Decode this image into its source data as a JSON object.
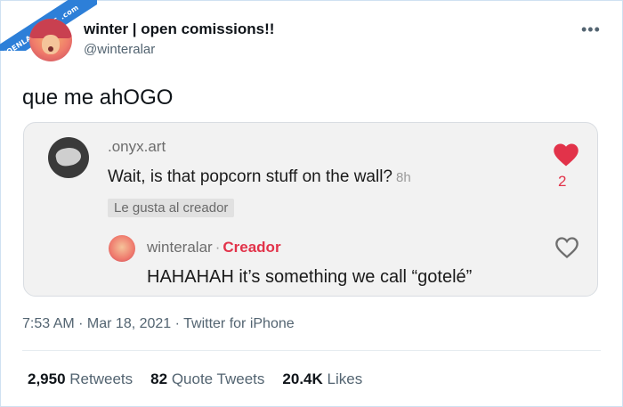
{
  "watermark": "VISTOENLASREDES .com",
  "author": {
    "name": "winter | open comissions!!",
    "handle": "@winteralar"
  },
  "tweet_text": "que me ahOGO",
  "card": {
    "commenter": ".onyx.art",
    "comment": "Wait, is that popcorn stuff on the wall?",
    "comment_time": "8h",
    "liked_badge": "Le gusta al creador",
    "like_count": "2",
    "reply_user": "winteralar",
    "reply_sep": "·",
    "reply_role": "Creador",
    "reply_text": "HAHAHAH it’s something we call “gotelé”"
  },
  "meta": "7:53 AM · Mar 18, 2021 · Twitter for iPhone",
  "stats": {
    "retweets_count": "2,950",
    "retweets_label": "Retweets",
    "quotes_count": "82",
    "quotes_label": "Quote Tweets",
    "likes_count": "20.4K",
    "likes_label": "Likes"
  },
  "colors": {
    "accent_red": "#e2334a",
    "watermark_blue": "#2d7fd8",
    "text_secondary": "#536471"
  },
  "icons": [
    "more-icon",
    "heart-filled-icon",
    "heart-outline-icon"
  ]
}
